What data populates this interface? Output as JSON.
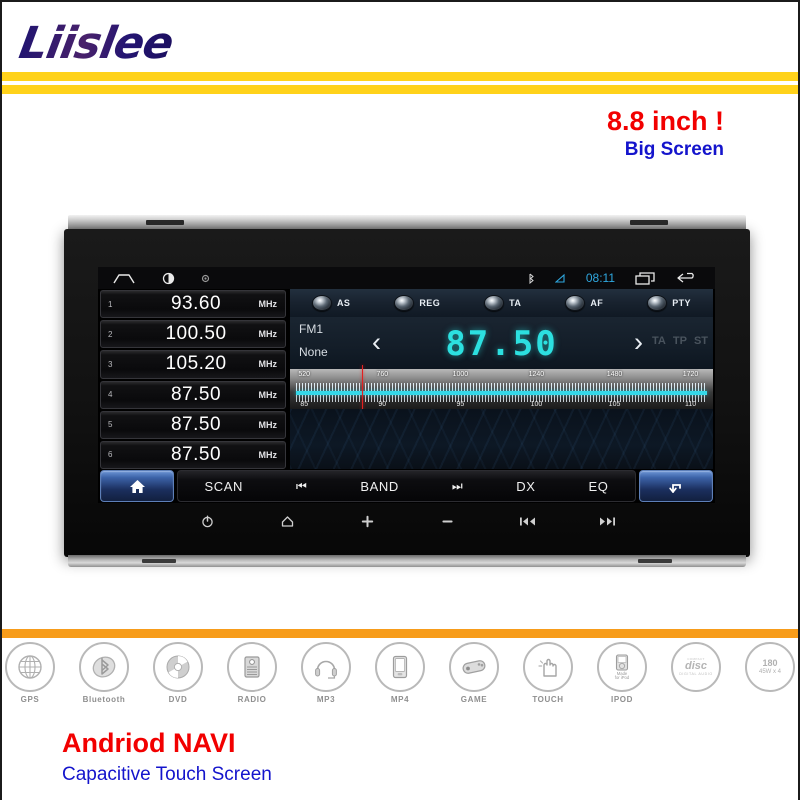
{
  "brand": {
    "logo": "Liislee"
  },
  "promo": {
    "inch": "8.8 inch !",
    "subtitle": "Big Screen"
  },
  "footer": {
    "title": "Andriod NAVI",
    "subtitle": "Capacitive Touch Screen"
  },
  "device": {
    "statusbar": {
      "home_icon": "home-icon",
      "brightness_icon": "brightness-icon",
      "dot_icon": "dot-icon",
      "bt_icon": "bluetooth-icon",
      "mute_icon": "mute-icon",
      "clock": "08:11",
      "recents_icon": "recents-icon",
      "back_icon": "back-icon"
    },
    "presets": [
      {
        "index": "1",
        "freq": "93.60",
        "unit": "MHz"
      },
      {
        "index": "2",
        "freq": "100.50",
        "unit": "MHz"
      },
      {
        "index": "3",
        "freq": "105.20",
        "unit": "MHz"
      },
      {
        "index": "4",
        "freq": "87.50",
        "unit": "MHz"
      },
      {
        "index": "5",
        "freq": "87.50",
        "unit": "MHz"
      },
      {
        "index": "6",
        "freq": "87.50",
        "unit": "MHz"
      }
    ],
    "rds_buttons": [
      {
        "label": "AS"
      },
      {
        "label": "REG"
      },
      {
        "label": "TA"
      },
      {
        "label": "AF"
      },
      {
        "label": "PTY"
      }
    ],
    "tuner": {
      "band": "FM1",
      "station_name": "None",
      "frequency": "87.50",
      "prev_icon": "chevron-left-icon",
      "next_icon": "chevron-right-icon",
      "flags": [
        "TA",
        "TP",
        "ST"
      ],
      "accent": "#2ce0e0",
      "needle_color": "#e22020",
      "am_scale": [
        "520",
        "760",
        "1000",
        "1240",
        "1480",
        "1720"
      ],
      "fm_scale": [
        "85",
        "90",
        "95",
        "100",
        "105",
        "110"
      ],
      "needle_percent": 17
    },
    "toolbar": {
      "home_icon": "home-icon",
      "back_icon": "return-icon",
      "items": [
        {
          "label": "SCAN",
          "type": "text"
        },
        {
          "label": "⏮",
          "type": "icon"
        },
        {
          "label": "BAND",
          "type": "text"
        },
        {
          "label": "⏭",
          "type": "icon"
        },
        {
          "label": "DX",
          "type": "text"
        },
        {
          "label": "EQ",
          "type": "text"
        }
      ]
    },
    "hardware_keys": [
      {
        "name": "power-key",
        "glyph": "⏻"
      },
      {
        "name": "home-key",
        "glyph": "⌂"
      },
      {
        "name": "volume-up-key",
        "glyph": "+"
      },
      {
        "name": "volume-down-key",
        "glyph": "−"
      },
      {
        "name": "prev-track-key",
        "glyph": "⏮"
      },
      {
        "name": "next-track-key",
        "glyph": "⏭"
      }
    ]
  },
  "features": [
    {
      "label": "GPS",
      "icon": "globe-icon"
    },
    {
      "label": "Bluetooth",
      "icon": "bluetooth-icon"
    },
    {
      "label": "DVD",
      "icon": "disc-icon"
    },
    {
      "label": "RADIO",
      "icon": "radio-icon"
    },
    {
      "label": "MP3",
      "icon": "headset-icon"
    },
    {
      "label": "MP4",
      "icon": "player-icon"
    },
    {
      "label": "GAME",
      "icon": "gamepad-icon"
    },
    {
      "label": "TOUCH",
      "icon": "hand-touch-icon"
    },
    {
      "label": "IPOD",
      "icon": "ipod-icon",
      "inner_text": "Made for iPod"
    },
    {
      "label": "",
      "icon": "compact-disc-logo-icon",
      "inner_text": "disc"
    },
    {
      "label": "",
      "icon": "power-rating-icon",
      "inner_text": "180",
      "inner_sub": "45W x 4"
    }
  ],
  "colors": {
    "yellow_bar": "#FFD21A",
    "orange_bar": "#F79C1A",
    "red_text": "#F20000",
    "blue_text": "#1414CC"
  }
}
